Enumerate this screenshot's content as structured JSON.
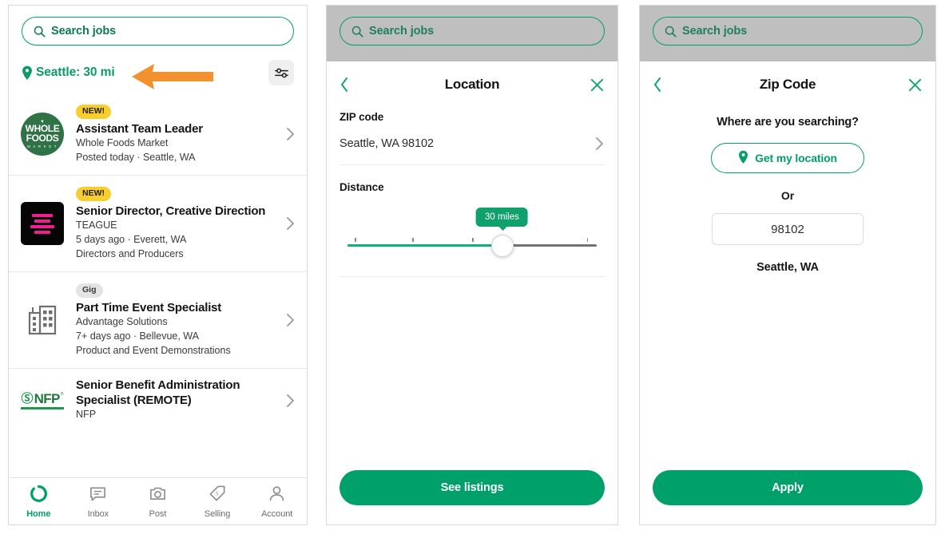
{
  "colors": {
    "brand_green": "#00a06a",
    "accent_yellow": "#F7CE2E",
    "arrow_orange": "#F2922F",
    "teague_pink": "#ED1E90",
    "backdrop_gray": "#bfbfbf"
  },
  "panel1": {
    "search": {
      "placeholder": "Search jobs",
      "icon": "search-icon"
    },
    "location": {
      "icon": "map-pin-icon",
      "text": "Seattle: 30 mi"
    },
    "filter_button": {
      "icon": "filter-sliders-icon"
    },
    "annotation": {
      "icon": "arrow-left-pointer",
      "color": "#F2922F"
    },
    "jobs": [
      {
        "badge": "NEW!",
        "badge_type": "new",
        "title": "Assistant Team Leader",
        "company": "Whole Foods Market",
        "meta": "Posted today · Seattle, WA",
        "category": "",
        "logo": "whole-foods-logo",
        "logo_lines": [
          "WHOLE",
          "FOODS",
          "M A R K E T"
        ]
      },
      {
        "badge": "NEW!",
        "badge_type": "new",
        "title": "Senior Director, Creative Direction",
        "company": "TEAGUE",
        "meta": "5 days ago · Everett, WA",
        "category": "Directors and Producers",
        "logo": "teague-logo"
      },
      {
        "badge": "Gig",
        "badge_type": "gig",
        "title": "Part Time Event Specialist",
        "company": "Advantage Solutions",
        "meta": "7+ days ago · Bellevue, WA",
        "category": "Product and Event Demonstrations",
        "logo": "building-icon"
      },
      {
        "badge": "",
        "badge_type": "",
        "title": "Senior Benefit Administration Specialist (REMOTE)",
        "company": "NFP",
        "meta": "",
        "category": "",
        "logo": "nfp-logo"
      }
    ],
    "bottom_nav": [
      {
        "label": "Home",
        "icon": "home-ring-icon",
        "active": true
      },
      {
        "label": "Inbox",
        "icon": "chat-bubble-icon",
        "active": false
      },
      {
        "label": "Post",
        "icon": "camera-icon",
        "active": false
      },
      {
        "label": "Selling",
        "icon": "price-tag-icon",
        "active": false
      },
      {
        "label": "Account",
        "icon": "person-icon",
        "active": false
      }
    ]
  },
  "panel2": {
    "search": {
      "placeholder": "Search jobs",
      "icon": "search-icon"
    },
    "sheet": {
      "back_icon": "chevron-left-icon",
      "close_icon": "close-x-icon",
      "title": "Location",
      "zip_label": "ZIP code",
      "zip_value": "Seattle, WA 98102",
      "zip_chevron": "chevron-right-icon",
      "distance_label": "Distance",
      "slider": {
        "bubble_label": "30 miles",
        "value": 30,
        "min": 0,
        "max": 50,
        "fill_percent": 62,
        "ticks_percent": [
          3,
          26,
          50,
          96
        ]
      },
      "primary_button": "See listings"
    }
  },
  "panel3": {
    "search": {
      "placeholder": "Search jobs",
      "icon": "search-icon"
    },
    "sheet": {
      "back_icon": "chevron-left-icon",
      "close_icon": "close-x-icon",
      "title": "Zip Code",
      "prompt": "Where are you searching?",
      "get_location_button": {
        "label": "Get my location",
        "icon": "map-pin-icon"
      },
      "or_text": "Or",
      "zip_input_value": "98102",
      "city_state": "Seattle, WA",
      "primary_button": "Apply"
    }
  }
}
